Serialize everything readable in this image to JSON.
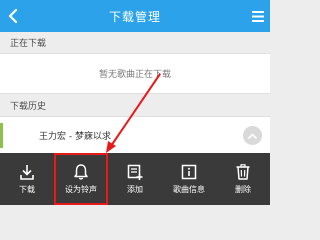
{
  "header": {
    "title": "下载管理"
  },
  "sections": {
    "downloading": {
      "title": "正在下载",
      "empty_text": "暂无歌曲正在下载"
    },
    "history": {
      "title": "下载历史",
      "items": [
        {
          "label": "王力宏 - 梦寐以求"
        }
      ]
    }
  },
  "toolbar": {
    "items": [
      {
        "label": "下载",
        "icon": "download-icon"
      },
      {
        "label": "设为铃声",
        "icon": "bell-icon",
        "highlighted": true
      },
      {
        "label": "添加",
        "icon": "add-to-list-icon"
      },
      {
        "label": "歌曲信息",
        "icon": "info-icon"
      },
      {
        "label": "删除",
        "icon": "trash-icon"
      }
    ]
  },
  "colors": {
    "header_bg": "#2ba2e9",
    "toolbar_bg": "#3a3a3a",
    "highlight": "#e81919",
    "accent": "#8bc34a"
  }
}
